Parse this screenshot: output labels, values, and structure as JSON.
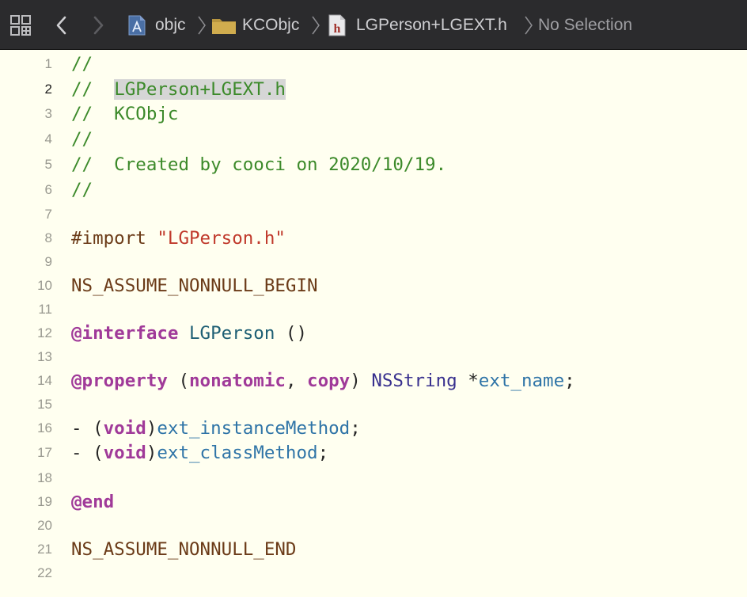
{
  "jumpbar": {
    "breadcrumbs": [
      {
        "label": "objc",
        "icon": "xcode-project-icon"
      },
      {
        "label": "KCObjc",
        "icon": "folder-icon"
      },
      {
        "label": "LGPerson+LGEXT.h",
        "icon": "header-file-icon"
      },
      {
        "label": "No Selection",
        "icon": ""
      }
    ],
    "colors": {
      "background": "#2b2b2d",
      "text": "#cfcfd2"
    }
  },
  "editor": {
    "current_line": 2,
    "colors": {
      "background": "#fffff0",
      "comment": "#3c8a2a",
      "macro": "#6b3b18",
      "string": "#c0392b",
      "keyword": "#a03a99",
      "class": "#1e5f74",
      "type": "#38308e",
      "identifier": "#2f74a7"
    },
    "lines": [
      {
        "number": "1",
        "tokens": [
          {
            "text": "//",
            "type": "comment"
          }
        ]
      },
      {
        "number": "2",
        "tokens": [
          {
            "text": "//  ",
            "type": "comment"
          },
          {
            "text": "LGPerson+LGEXT.h",
            "type": "comment",
            "highlight": true
          }
        ]
      },
      {
        "number": "3",
        "tokens": [
          {
            "text": "//  KCObjc",
            "type": "comment"
          }
        ]
      },
      {
        "number": "4",
        "tokens": [
          {
            "text": "//",
            "type": "comment"
          }
        ]
      },
      {
        "number": "5",
        "tokens": [
          {
            "text": "//  Created by cooci on 2020/10/19.",
            "type": "comment"
          }
        ]
      },
      {
        "number": "6",
        "tokens": [
          {
            "text": "//",
            "type": "comment"
          }
        ]
      },
      {
        "number": "7",
        "tokens": []
      },
      {
        "number": "8",
        "tokens": [
          {
            "text": "#import ",
            "type": "macro"
          },
          {
            "text": "\"LGPerson.h\"",
            "type": "string"
          }
        ]
      },
      {
        "number": "9",
        "tokens": []
      },
      {
        "number": "10",
        "tokens": [
          {
            "text": "NS_ASSUME_NONNULL_BEGIN",
            "type": "macro"
          }
        ]
      },
      {
        "number": "11",
        "tokens": []
      },
      {
        "number": "12",
        "tokens": [
          {
            "text": "@interface",
            "type": "keyword"
          },
          {
            "text": " ",
            "type": "plain"
          },
          {
            "text": "LGPerson",
            "type": "class"
          },
          {
            "text": " ()",
            "type": "plain"
          }
        ]
      },
      {
        "number": "13",
        "tokens": []
      },
      {
        "number": "14",
        "tokens": [
          {
            "text": "@property",
            "type": "keyword"
          },
          {
            "text": " (",
            "type": "plain"
          },
          {
            "text": "nonatomic",
            "type": "keyword"
          },
          {
            "text": ", ",
            "type": "plain"
          },
          {
            "text": "copy",
            "type": "keyword"
          },
          {
            "text": ") ",
            "type": "plain"
          },
          {
            "text": "NSString",
            "type": "type"
          },
          {
            "text": " *",
            "type": "plain"
          },
          {
            "text": "ext_name",
            "type": "ident"
          },
          {
            "text": ";",
            "type": "plain"
          }
        ]
      },
      {
        "number": "15",
        "tokens": []
      },
      {
        "number": "16",
        "tokens": [
          {
            "text": "- (",
            "type": "plain"
          },
          {
            "text": "void",
            "type": "keyword"
          },
          {
            "text": ")",
            "type": "plain"
          },
          {
            "text": "ext_instanceMethod",
            "type": "ident"
          },
          {
            "text": ";",
            "type": "plain"
          }
        ]
      },
      {
        "number": "17",
        "tokens": [
          {
            "text": "- (",
            "type": "plain"
          },
          {
            "text": "void",
            "type": "keyword"
          },
          {
            "text": ")",
            "type": "plain"
          },
          {
            "text": "ext_classMethod",
            "type": "ident"
          },
          {
            "text": ";",
            "type": "plain"
          }
        ]
      },
      {
        "number": "18",
        "tokens": []
      },
      {
        "number": "19",
        "tokens": [
          {
            "text": "@end",
            "type": "keyword"
          }
        ]
      },
      {
        "number": "20",
        "tokens": []
      },
      {
        "number": "21",
        "tokens": [
          {
            "text": "NS_ASSUME_NONNULL_END",
            "type": "macro"
          }
        ]
      },
      {
        "number": "22",
        "tokens": []
      }
    ]
  }
}
